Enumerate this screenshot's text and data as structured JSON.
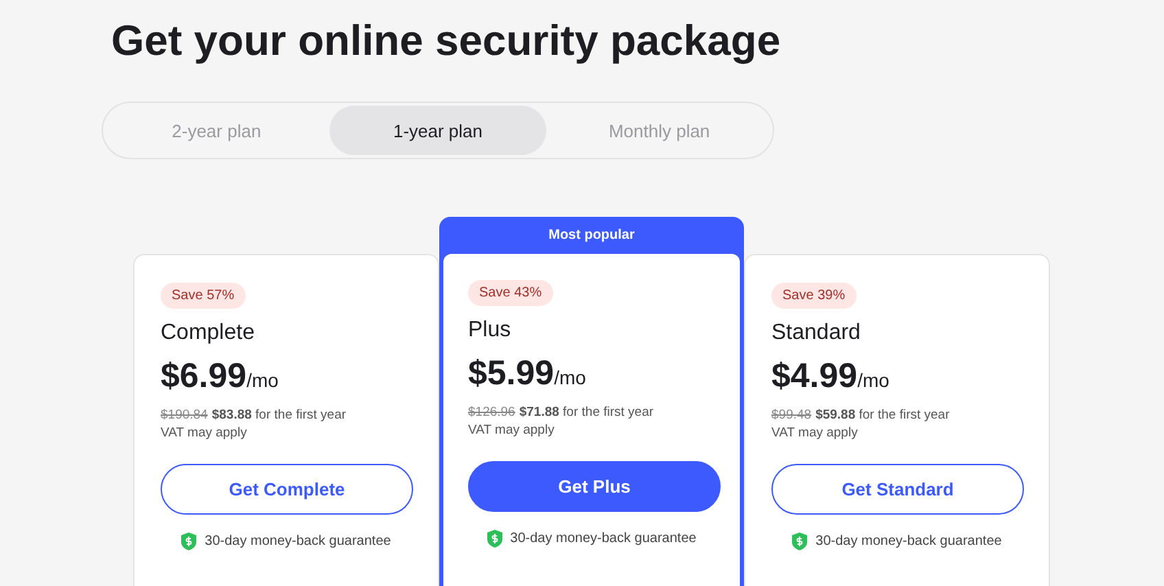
{
  "title": "Get your online security package",
  "tabs": [
    {
      "label": "2-year plan",
      "selected": false
    },
    {
      "label": "1-year plan",
      "selected": true
    },
    {
      "label": "Monthly plan",
      "selected": false
    }
  ],
  "plans": [
    {
      "featured": false,
      "badge": "Save 57%",
      "name": "Complete",
      "price": "$6.99",
      "per": "/mo",
      "old_price": "$190.84",
      "first_year": "**$83.88** for the first year",
      "vat": "VAT may apply",
      "button": "Get Complete",
      "guarantee": "30-day money-back guarantee"
    },
    {
      "featured": true,
      "banner": "Most popular",
      "badge": "Save 43%",
      "name": "Plus",
      "price": "$5.99",
      "per": "/mo",
      "old_price": "$126.96",
      "first_year": "**$71.88** for the first year",
      "vat": "VAT may apply",
      "button": "Get Plus",
      "guarantee": "30-day money-back guarantee"
    },
    {
      "featured": false,
      "badge": "Save 39%",
      "name": "Standard",
      "price": "$4.99",
      "per": "/mo",
      "old_price": "$99.48",
      "first_year": "**$59.88** for the first year",
      "vat": "VAT may apply",
      "button": "Get Standard",
      "guarantee": "30-day money-back guarantee"
    }
  ]
}
